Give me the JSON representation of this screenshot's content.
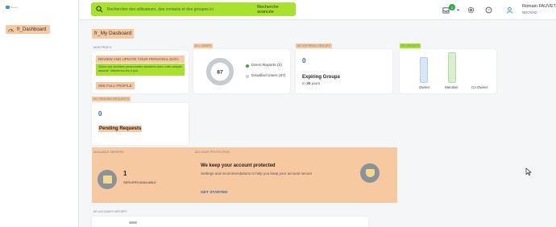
{
  "sidebar": {
    "logo_text": "Nexus",
    "items": [
      {
        "label": "fr_Dashboard"
      }
    ]
  },
  "topbar": {
    "search_placeholder": "Rechercher des utilisateurs, des contacts et des groupes ici",
    "advanced_search": "Recherche avancée",
    "notification_count": "0",
    "user_name": "Romain FAUVET",
    "user_org": "NEOVAD"
  },
  "page": {
    "title": "fr_My Dasboard"
  },
  "profile": {
    "section": "MON PROFIL",
    "review_link": "REVIEW AND UPDATE YOUR PERSONAL DATA",
    "description": "Gérez vos données personnelles stockées avec votre compte associé. Maintenez-les à jour.",
    "full_profile": "SEE FULL PROFILE"
  },
  "users": {
    "section": "ALL USERS",
    "total": "87",
    "legend": [
      {
        "label": "Direct Reports (0)",
        "color": "#2daa4f"
      },
      {
        "label": "Disabled Users (87)",
        "color": "#c8ccd0"
      }
    ]
  },
  "groups_expiring": {
    "section": "MY EXPIRING GROUPS",
    "count": "0",
    "label": "Expiring Groups",
    "sub_prefix": "in",
    "sub_value": "30",
    "sub_suffix": "jours"
  },
  "my_groups": {
    "section": "MY GROUPS",
    "chart_data": {
      "type": "bar",
      "categories": [
        "Owner",
        "Member",
        "Co Owner"
      ],
      "values": [
        0.85,
        1.0,
        0
      ],
      "colors": [
        "#d6e6f5",
        "#d8f0d0",
        "#ffffff"
      ]
    }
  },
  "pending": {
    "section": "MY PENDING REQUESTS",
    "count": "0",
    "label": "Pending Requests"
  },
  "servers": {
    "section": "AVAILABLE SERVERS",
    "count": "1",
    "label": "SERVERS AVAILABLE"
  },
  "protection": {
    "section": "ACCOUNT PROTECTION",
    "title": "We keep your account protected",
    "description": "Settings and recommendations to help you keep your account secure",
    "cta": "GET STARTED"
  },
  "history": {
    "section": "MY ACCOUNT HISTORY"
  },
  "colors": {
    "accent_green": "#a7e22c",
    "accent_orange": "#f7c9a0",
    "link_blue": "#2b6cb0"
  }
}
